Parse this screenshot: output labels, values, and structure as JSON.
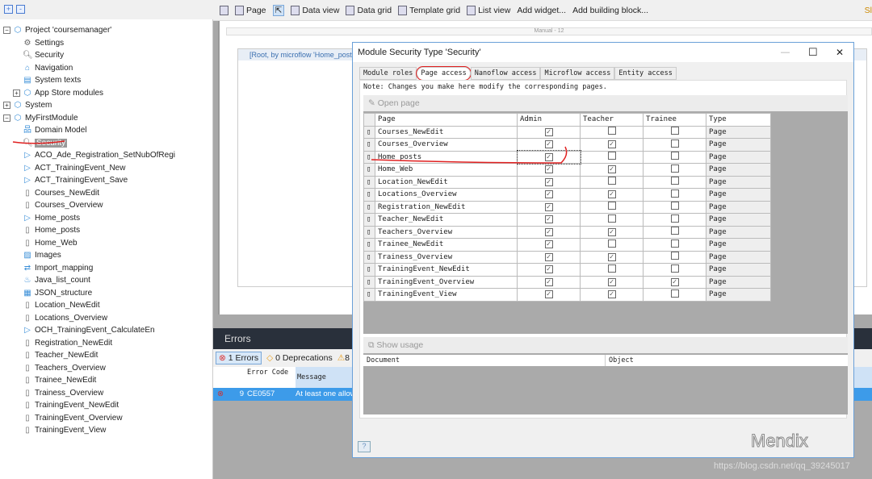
{
  "tree": {
    "expand_all": "+",
    "collapse_all": "-",
    "items": [
      {
        "label": "Project 'coursemanager'",
        "level": 0,
        "exp": "−",
        "icon": "project-icon"
      },
      {
        "label": "Settings",
        "level": 1,
        "icon": "gear-icon"
      },
      {
        "label": "Security",
        "level": 1,
        "icon": "key-icon"
      },
      {
        "label": "Navigation",
        "level": 1,
        "icon": "home-icon"
      },
      {
        "label": "System texts",
        "level": 1,
        "icon": "text-icon"
      },
      {
        "label": "App Store modules",
        "level": 1,
        "exp": "+",
        "icon": "module-icon"
      },
      {
        "label": "System",
        "level": 0,
        "exp": "+",
        "icon": "module-icon"
      },
      {
        "label": "MyFirstModule",
        "level": 0,
        "exp": "−",
        "icon": "module-icon"
      },
      {
        "label": "Domain Model",
        "level": 1,
        "icon": "domain-model-icon"
      },
      {
        "label": "Security",
        "level": 1,
        "icon": "key-icon",
        "selected": true
      },
      {
        "label": "ACO_Ade_Registration_SetNubOfRegi",
        "level": 1,
        "icon": "microflow-icon"
      },
      {
        "label": "ACT_TrainingEvent_New",
        "level": 1,
        "icon": "microflow-icon"
      },
      {
        "label": "ACT_TrainingEvent_Save",
        "level": 1,
        "icon": "microflow-icon"
      },
      {
        "label": "Courses_NewEdit",
        "level": 1,
        "icon": "page-icon"
      },
      {
        "label": "Courses_Overview",
        "level": 1,
        "icon": "page-icon"
      },
      {
        "label": "Home_posts",
        "level": 1,
        "icon": "microflow-icon"
      },
      {
        "label": "Home_posts",
        "level": 1,
        "icon": "page-icon"
      },
      {
        "label": "Home_Web",
        "level": 1,
        "icon": "page-icon"
      },
      {
        "label": "Images",
        "level": 1,
        "icon": "images-icon"
      },
      {
        "label": "Import_mapping",
        "level": 1,
        "icon": "mapping-icon"
      },
      {
        "label": "Java_list_count",
        "level": 1,
        "icon": "java-icon"
      },
      {
        "label": "JSON_structure",
        "level": 1,
        "icon": "json-icon"
      },
      {
        "label": "Location_NewEdit",
        "level": 1,
        "icon": "page-icon"
      },
      {
        "label": "Locations_Overview",
        "level": 1,
        "icon": "page-icon"
      },
      {
        "label": "OCH_TrainingEvent_CalculateEn",
        "level": 1,
        "icon": "microflow-icon"
      },
      {
        "label": "Registration_NewEdit",
        "level": 1,
        "icon": "page-icon"
      },
      {
        "label": "Teacher_NewEdit",
        "level": 1,
        "icon": "page-icon"
      },
      {
        "label": "Teachers_Overview",
        "level": 1,
        "icon": "page-icon"
      },
      {
        "label": "Trainee_NewEdit",
        "level": 1,
        "icon": "page-icon"
      },
      {
        "label": "Trainess_Overview",
        "level": 1,
        "icon": "page-icon"
      },
      {
        "label": "TrainingEvent_NewEdit",
        "level": 1,
        "icon": "page-icon"
      },
      {
        "label": "TrainingEvent_Overview",
        "level": 1,
        "icon": "page-icon"
      },
      {
        "label": "TrainingEvent_View",
        "level": 1,
        "icon": "page-icon"
      }
    ]
  },
  "toolbar": {
    "items": [
      "Page",
      "Data view",
      "Data grid",
      "Template grid",
      "List view"
    ],
    "add_widget": "Add widget...",
    "add_block": "Add building block...",
    "right": "Sl"
  },
  "canvas": {
    "ruler": "Manual - 12",
    "dataview": "[Root, by microflow 'Home_posts'"
  },
  "errors": {
    "title": "Errors",
    "errors_btn": "1 Errors",
    "deprecations_btn": "0 Deprecations",
    "warnings_btn": "8",
    "col_code": "Error Code",
    "col_message": "Message",
    "row": {
      "num": "9",
      "code": "CE0557",
      "message": "At least one allowed role"
    }
  },
  "dialog": {
    "title": "Module Security Type 'Security'",
    "tabs": [
      "Module roles",
      "Page access",
      "Nanoflow access",
      "Microflow access",
      "Entity access"
    ],
    "active_tab": 1,
    "note": "Note: Changes you make here modify the corresponding pages.",
    "open_page": "Open page",
    "columns": [
      "Page",
      "Admin",
      "Teacher",
      "Trainee",
      "Type"
    ],
    "rows": [
      {
        "page": "Courses_NewEdit",
        "admin": true,
        "teacher": false,
        "trainee": false,
        "type": "Page"
      },
      {
        "page": "Courses_Overview",
        "admin": true,
        "teacher": true,
        "trainee": false,
        "type": "Page"
      },
      {
        "page": "Home_posts",
        "admin": true,
        "teacher": false,
        "trainee": false,
        "type": "Page"
      },
      {
        "page": "Home_Web",
        "admin": true,
        "teacher": true,
        "trainee": false,
        "type": "Page"
      },
      {
        "page": "Location_NewEdit",
        "admin": true,
        "teacher": false,
        "trainee": false,
        "type": "Page"
      },
      {
        "page": "Locations_Overview",
        "admin": true,
        "teacher": true,
        "trainee": false,
        "type": "Page"
      },
      {
        "page": "Registration_NewEdit",
        "admin": true,
        "teacher": false,
        "trainee": false,
        "type": "Page"
      },
      {
        "page": "Teacher_NewEdit",
        "admin": true,
        "teacher": false,
        "trainee": false,
        "type": "Page"
      },
      {
        "page": "Teachers_Overview",
        "admin": true,
        "teacher": true,
        "trainee": false,
        "type": "Page"
      },
      {
        "page": "Trainee_NewEdit",
        "admin": true,
        "teacher": false,
        "trainee": false,
        "type": "Page"
      },
      {
        "page": "Trainess_Overview",
        "admin": true,
        "teacher": true,
        "trainee": false,
        "type": "Page"
      },
      {
        "page": "TrainingEvent_NewEdit",
        "admin": true,
        "teacher": false,
        "trainee": false,
        "type": "Page"
      },
      {
        "page": "TrainingEvent_Overview",
        "admin": true,
        "teacher": true,
        "trainee": true,
        "type": "Page"
      },
      {
        "page": "TrainingEvent_View",
        "admin": true,
        "teacher": true,
        "trainee": false,
        "type": "Page"
      }
    ],
    "show_usage": "Show usage",
    "usage_columns": [
      "Document",
      "Object"
    ]
  },
  "watermark": {
    "brand": "Mendix",
    "url": "https://blog.csdn.net/qq_39245017"
  },
  "colors": {
    "selection": "#3d9be9",
    "annotation": "#e02020",
    "errors_header": "#29303b"
  }
}
